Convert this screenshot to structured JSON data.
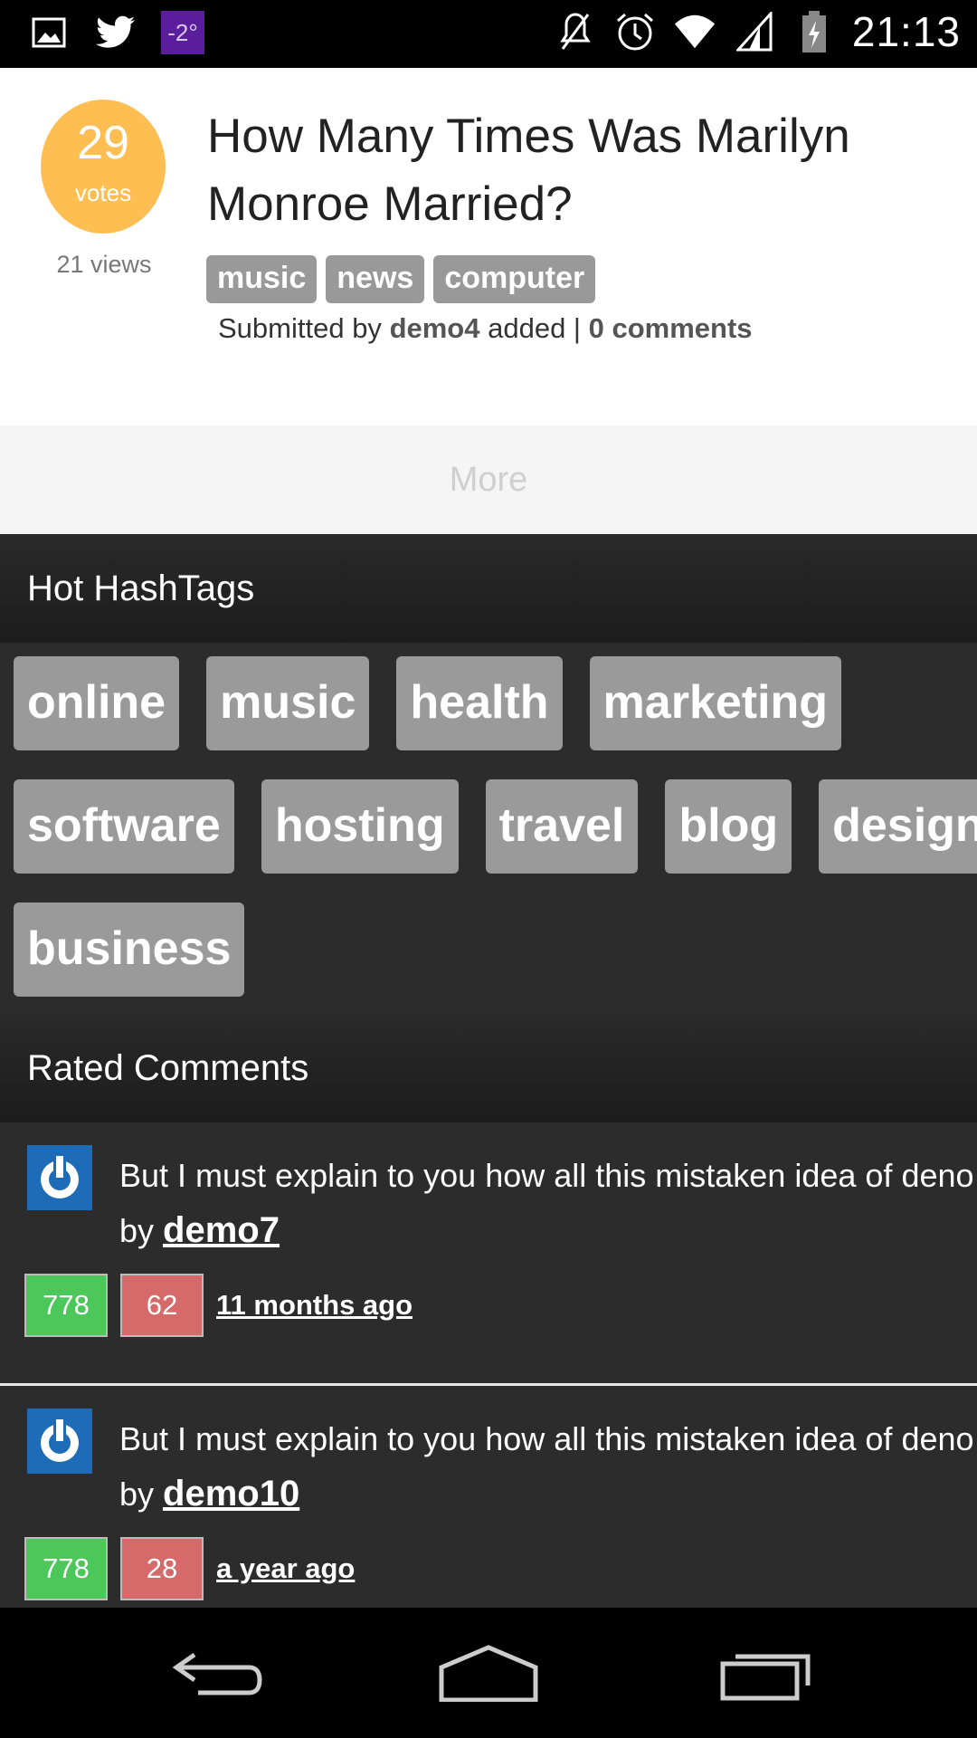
{
  "status_bar": {
    "icons_left": [
      "image-icon",
      "twitter-icon"
    ],
    "temperature": "-2°",
    "icons_right": [
      "mute-icon",
      "alarm-icon",
      "wifi-icon",
      "signal-icon",
      "battery-icon"
    ],
    "time": "21:13"
  },
  "post": {
    "votes": "29",
    "votes_label": "votes",
    "views": "21 views",
    "title": "How Many Times Was Marilyn Monroe Married?",
    "tags": [
      "music",
      "news",
      "computer"
    ],
    "meta_prefix": "Submitted by",
    "author": "demo4",
    "meta_middle": "added |",
    "comments": "0 comments"
  },
  "more_label": "More",
  "hashtags": {
    "title": "Hot HashTags",
    "rows": [
      [
        "online",
        "music",
        "health",
        "marketing"
      ],
      [
        "software",
        "hosting",
        "travel",
        "blog",
        "design"
      ],
      [
        "business"
      ]
    ]
  },
  "rated_comments": {
    "title": "Rated Comments",
    "items": [
      {
        "text": "But I must explain to you how all this mistaken idea of deno",
        "by": "by",
        "author": "demo7",
        "up": "778",
        "down": "62",
        "time": "11 months ago"
      },
      {
        "text": "But I must explain to you how all this mistaken idea of deno",
        "by": "by",
        "author": "demo10",
        "up": "778",
        "down": "28",
        "time": "a year ago"
      }
    ]
  },
  "nav": [
    "back-icon",
    "home-icon",
    "recents-icon"
  ],
  "colors": {
    "vote_circle": "#ffbe52",
    "upvote": "#4cc75a",
    "downvote": "#d66a6a",
    "avatar": "#1e6bb8"
  }
}
